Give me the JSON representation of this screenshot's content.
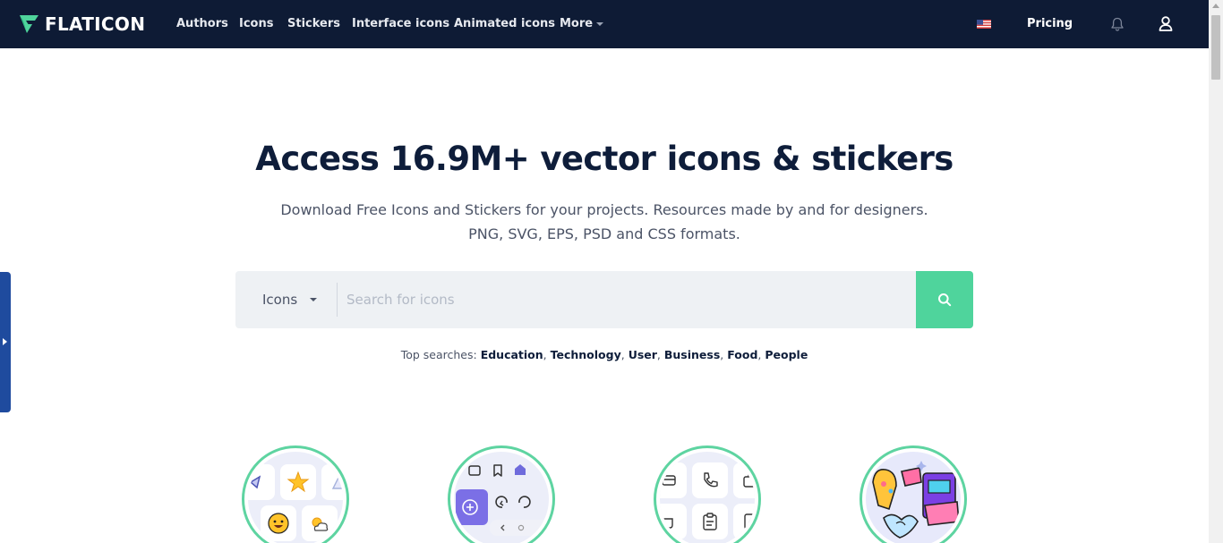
{
  "header": {
    "logo_text": "FLATICON",
    "nav": [
      {
        "label": "Authors"
      },
      {
        "label": "Icons"
      },
      {
        "label": "Stickers"
      },
      {
        "label": "Interface icons"
      },
      {
        "label": "Animated icons"
      },
      {
        "label": "More"
      }
    ],
    "pricing_label": "Pricing",
    "flag_icon": "us-flag-icon",
    "notification_icon": "bell-icon",
    "account_icon": "user-icon"
  },
  "hero": {
    "title": "Access 16.9M+ vector icons & stickers",
    "subtitle_line1": "Download Free Icons and Stickers for your projects. Resources made by and for designers.",
    "subtitle_line2": "PNG, SVG, EPS, PSD and CSS formats."
  },
  "search": {
    "type_selected": "Icons",
    "placeholder": "Search for icons",
    "button_icon": "search-icon"
  },
  "top_searches": {
    "label": "Top searches:",
    "items": [
      "Education",
      "Technology",
      "User",
      "Business",
      "Food",
      "People"
    ]
  },
  "categories": [
    {
      "icon": "icons-category-icon"
    },
    {
      "icon": "interface-icons-category-icon"
    },
    {
      "icon": "animated-icons-category-icon"
    },
    {
      "icon": "stickers-category-icon"
    }
  ],
  "colors": {
    "header_bg": "#0e1b35",
    "accent_green": "#4fd49c",
    "side_tab": "#1f4b9e",
    "title_text": "#0e1d3a"
  }
}
